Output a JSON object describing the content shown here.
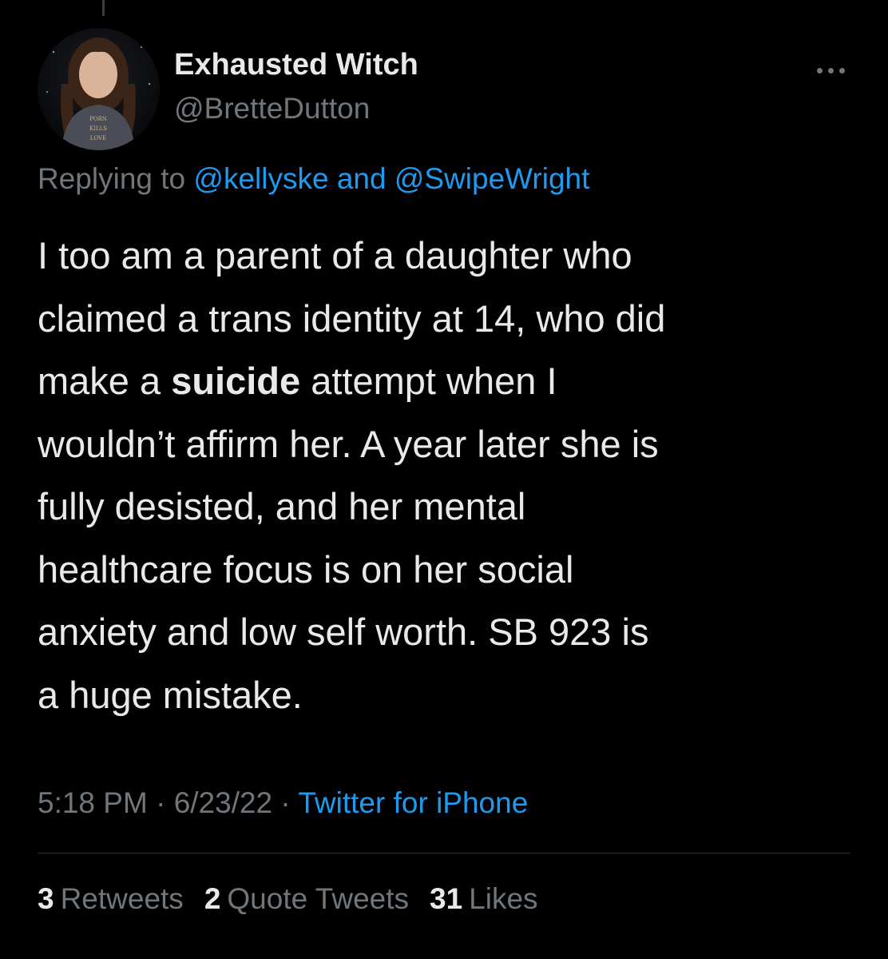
{
  "tweet": {
    "display_name": "Exhausted Witch",
    "handle": "@BretteDutton",
    "avatar_shirt_text": [
      "PORN",
      "KILLS",
      "LOVE"
    ],
    "replying_to": {
      "prefix": "Replying to",
      "mention1": "@kellyske",
      "joiner": "and",
      "mention2": "@SwipeWright"
    },
    "text": {
      "line1": "I too am a parent of a daughter who",
      "line2": "claimed a trans identity at 14, who did",
      "line3_before": "make a",
      "line3_bold": "suicide",
      "line3_after": "attempt when I",
      "line4": "wouldn’t affirm her. A year later she is",
      "line5": "fully desisted, and her mental",
      "line6": "healthcare focus is on her social",
      "line7": "anxiety and low self worth. SB 923 is",
      "line8": "a huge mistake."
    },
    "time": "5:18 PM",
    "separator": "·",
    "date": "6/23/22",
    "source": "Twitter for iPhone",
    "stats": {
      "retweets_count": "3",
      "retweets_label": "Retweets",
      "quotes_count": "2",
      "quotes_label": "Quote Tweets",
      "likes_count": "31",
      "likes_label": "Likes"
    }
  },
  "colors": {
    "background": "#000000",
    "primary_text": "#e7e9ea",
    "secondary_text": "#71767b",
    "link": "#1d9bf0",
    "divider": "#2f3336"
  }
}
